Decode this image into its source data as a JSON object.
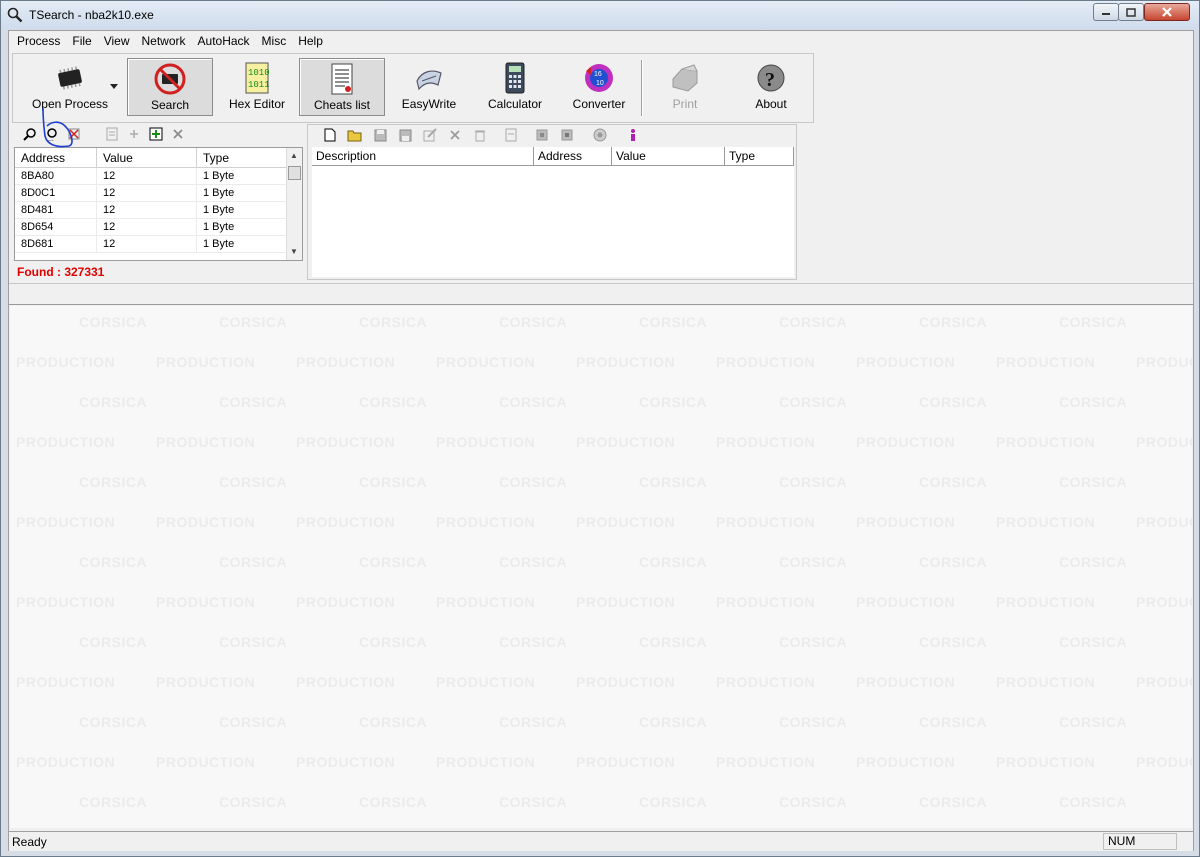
{
  "window": {
    "title": "TSearch - nba2k10.exe"
  },
  "menu": [
    "Process",
    "File",
    "View",
    "Network",
    "AutoHack",
    "Misc",
    "Help"
  ],
  "toolbar": {
    "open_process": "Open Process",
    "search": "Search",
    "hex_editor": "Hex Editor",
    "cheats_list": "Cheats list",
    "easywrite": "EasyWrite",
    "calculator": "Calculator",
    "converter": "Converter",
    "print": "Print",
    "about": "About"
  },
  "results": {
    "columns": [
      "Address",
      "Value",
      "Type"
    ],
    "rows": [
      {
        "address": "8BA80",
        "value": "12",
        "type": "1 Byte"
      },
      {
        "address": "8D0C1",
        "value": "12",
        "type": "1 Byte"
      },
      {
        "address": "8D481",
        "value": "12",
        "type": "1 Byte"
      },
      {
        "address": "8D654",
        "value": "12",
        "type": "1 Byte"
      },
      {
        "address": "8D681",
        "value": "12",
        "type": "1 Byte"
      }
    ],
    "found": "Found : 327331"
  },
  "cheats": {
    "columns": [
      "Description",
      "Address",
      "Value",
      "Type"
    ]
  },
  "watermark": {
    "line1": "CORSICA",
    "line2": "PRODUCTION"
  },
  "status": {
    "text": "Ready",
    "num": "NUM"
  },
  "colors": {
    "found": "#e00000",
    "annotation": "#1f3fd0"
  }
}
